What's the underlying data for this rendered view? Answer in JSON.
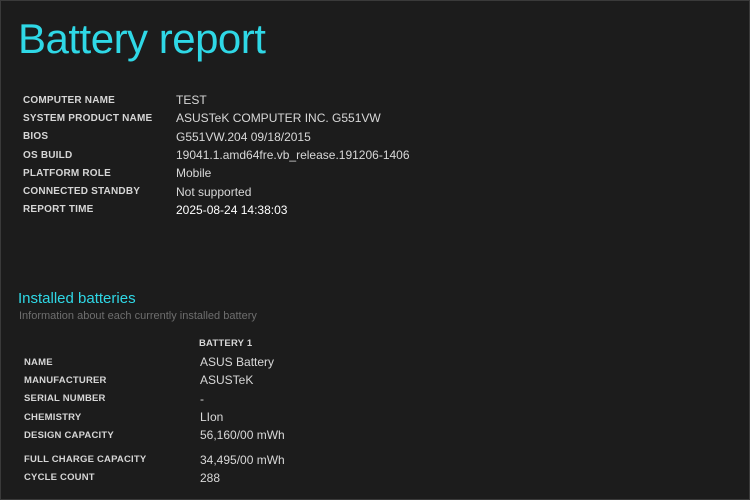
{
  "title": "Battery report",
  "info": [
    {
      "label": "COMPUTER NAME",
      "value": "TEST"
    },
    {
      "label": "SYSTEM PRODUCT NAME",
      "value": "ASUSTeK COMPUTER INC. G551VW"
    },
    {
      "label": "BIOS",
      "value": "G551VW.204 09/18/2015"
    },
    {
      "label": "OS BUILD",
      "value": "19041.1.amd64fre.vb_release.191206-1406"
    },
    {
      "label": "PLATFORM ROLE",
      "value": "Mobile"
    },
    {
      "label": "CONNECTED STANDBY",
      "value": "Not supported"
    },
    {
      "label": "REPORT TIME",
      "value": "2025-08-24  14:38:03"
    }
  ],
  "installed": {
    "title": "Installed batteries",
    "subtitle": "Information about each currently installed battery",
    "battery_header": "BATTERY 1",
    "rows": [
      {
        "label": "NAME",
        "value": "ASUS Battery"
      },
      {
        "label": "MANUFACTURER",
        "value": "ASUSTeK"
      },
      {
        "label": "SERIAL NUMBER",
        "value": "-"
      },
      {
        "label": "CHEMISTRY",
        "value": "LIon"
      },
      {
        "label": "DESIGN CAPACITY",
        "value": "56,160/00 mWh"
      },
      {
        "label": "FULL CHARGE CAPACITY",
        "value": "34,495/00 mWh"
      },
      {
        "label": "CYCLE COUNT",
        "value": "288"
      }
    ]
  },
  "colors": {
    "background": "#1c1c1c",
    "accent": "#2fd8e6",
    "text": "#d8d8d8",
    "muted": "#6e6e6e"
  }
}
